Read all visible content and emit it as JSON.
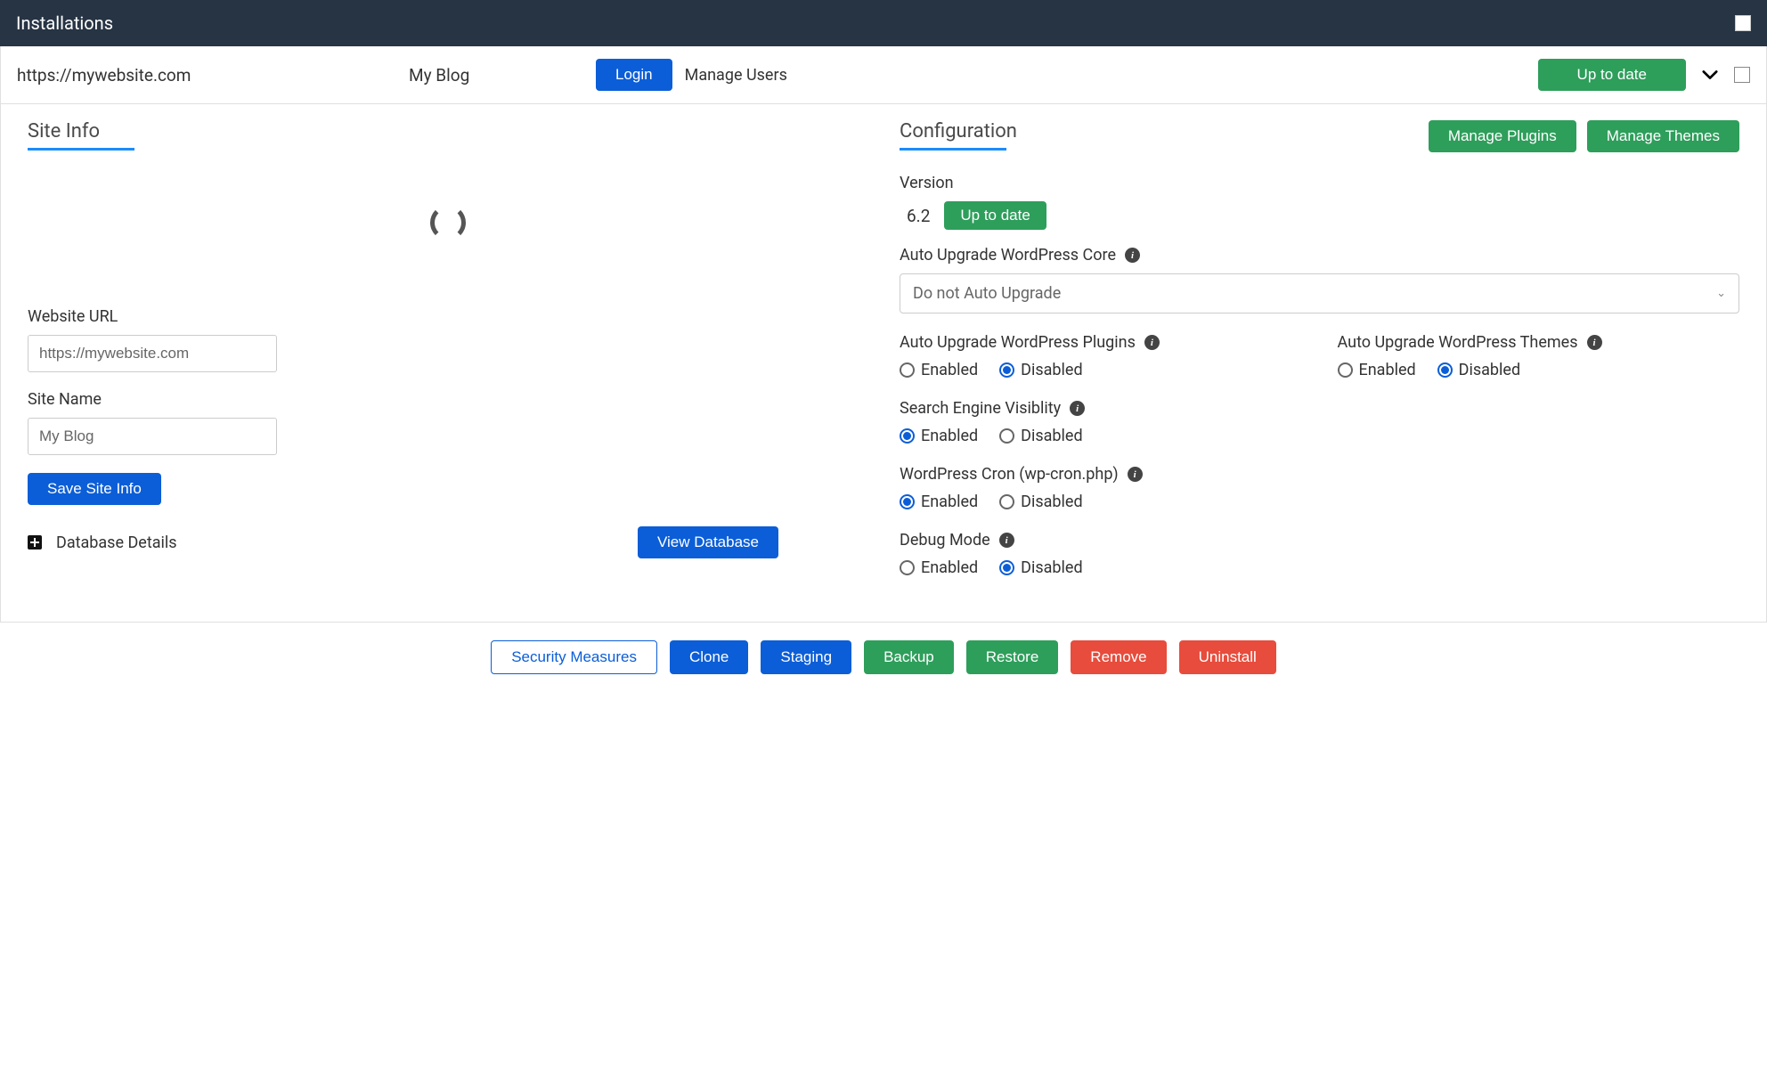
{
  "header": {
    "title": "Installations"
  },
  "install": {
    "url": "https://mywebsite.com",
    "name": "My Blog",
    "login_btn": "Login",
    "manage_users": "Manage Users",
    "status_btn": "Up to date"
  },
  "site_info": {
    "title": "Site Info",
    "website_url_label": "Website URL",
    "website_url_value": "https://mywebsite.com",
    "site_name_label": "Site Name",
    "site_name_value": "My Blog",
    "save_btn": "Save Site Info",
    "db_details": "Database Details",
    "view_db_btn": "View Database"
  },
  "config": {
    "title": "Configuration",
    "manage_plugins_btn": "Manage Plugins",
    "manage_themes_btn": "Manage Themes",
    "version_label": "Version",
    "version_value": "6.2",
    "version_badge": "Up to date",
    "auto_core_label": "Auto Upgrade WordPress Core",
    "auto_core_select": "Do not Auto Upgrade",
    "auto_plugins_label": "Auto Upgrade WordPress Plugins",
    "auto_themes_label": "Auto Upgrade WordPress Themes",
    "search_vis_label": "Search Engine Visiblity",
    "cron_label": "WordPress Cron (wp-cron.php)",
    "debug_label": "Debug Mode",
    "opt_enabled": "Enabled",
    "opt_disabled": "Disabled"
  },
  "footer": {
    "security": "Security Measures",
    "clone": "Clone",
    "staging": "Staging",
    "backup": "Backup",
    "restore": "Restore",
    "remove": "Remove",
    "uninstall": "Uninstall"
  }
}
